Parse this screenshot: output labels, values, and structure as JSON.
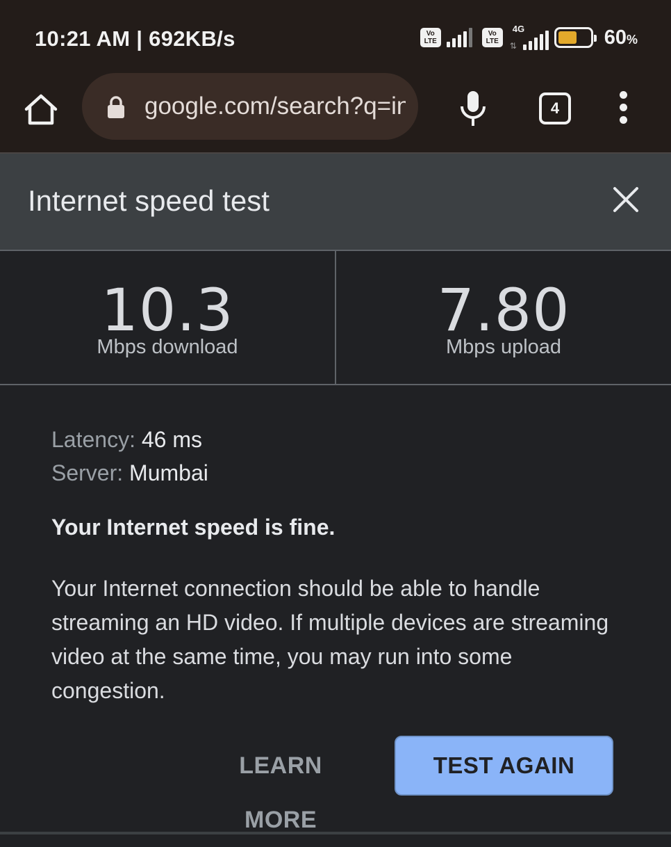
{
  "status_bar": {
    "time_speed": "10:21 AM | 692KB/s",
    "volte_labels": [
      "Vo",
      "LTE"
    ],
    "network_type": "4G",
    "battery_percent": "60",
    "battery_percent_suffix": "%",
    "battery_level": 0.6,
    "battery_color": "#e3a92b"
  },
  "browser": {
    "url": "google.com/search?q=internet+speed+test",
    "tab_count": "4",
    "icons": [
      "home-icon",
      "lock-icon",
      "mic-icon",
      "tab-switcher-icon",
      "more-vert-icon"
    ]
  },
  "speed_test": {
    "title": "Internet speed test",
    "download": {
      "value": "10.3",
      "caption": "Mbps download"
    },
    "upload": {
      "value": "7.80",
      "caption": "Mbps upload"
    },
    "latency_label": "Latency:",
    "latency_value": "46 ms",
    "server_label": "Server:",
    "server_value": "Mumbai",
    "verdict": "Your Internet speed is fine.",
    "description": "Your Internet connection should be able to handle streaming an HD video. If multiple devices are streaming video at the same time, you may run into some congestion.",
    "learn_more_label": "LEARN MORE",
    "test_again_label": "TEST AGAIN",
    "accent_color": "#8ab4f8"
  }
}
